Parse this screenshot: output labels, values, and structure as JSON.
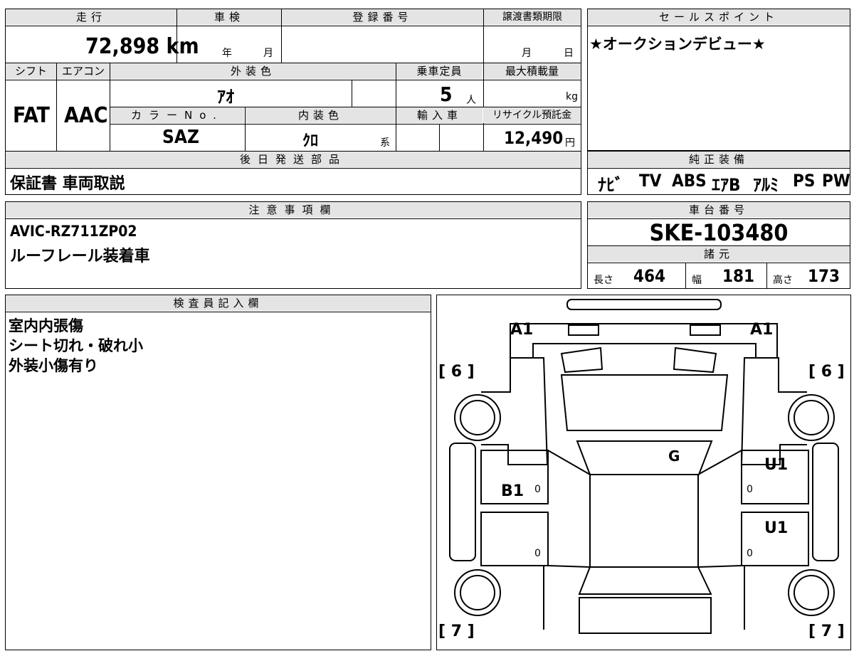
{
  "top_grid": {
    "mileage_header": "走行",
    "shaken_header": "車検",
    "registration_header": "登録番号",
    "transfer_deadline_header": "譲渡書類期限",
    "mileage_value": "72,898 km",
    "shaken_year_unit": "年",
    "shaken_month_unit": "月",
    "deadline_month_unit": "月",
    "deadline_day_unit": "日",
    "shift_header": "シフト",
    "ac_header": "エアコン",
    "exterior_color_header": "外装色",
    "capacity_header": "乗車定員",
    "max_load_header": "最大積載量",
    "shift_value": "FAT",
    "ac_value": "AAC",
    "exterior_color_value": "ｱｵ",
    "capacity_value": "5",
    "capacity_unit": "人",
    "max_load_unit": "kg",
    "color_no_header": "カラーNo.",
    "interior_color_header": "内装色",
    "import_header": "輸入車",
    "recycle_header": "リサイクル預託金",
    "color_no_value": "SAZ",
    "interior_color_value": "ｸﾛ",
    "interior_color_suffix": "系",
    "recycle_value": "12,490",
    "recycle_unit": "円",
    "later_parts_header": "後日発送部品",
    "later_parts_value": "保証書 車両取説"
  },
  "sales_point": {
    "header": "セールスポイント",
    "text": "★オークションデビュー★"
  },
  "genuine_equipment": {
    "header": "純正装備",
    "items": [
      "ﾅﾋﾞ",
      "TV",
      "ABS",
      "ｴｱB",
      "ｱﾙﾐ",
      "PS",
      "PW"
    ]
  },
  "notes": {
    "header": "注意事項欄",
    "lines": [
      "AVIC-RZ711ZP02",
      "ルーフレール装着車"
    ]
  },
  "chassis": {
    "header": "車台番号",
    "value": "SKE-103480"
  },
  "specs": {
    "header": "諸元",
    "length_label": "長さ",
    "length_value": "464",
    "width_label": "幅",
    "width_value": "181",
    "height_label": "高さ",
    "height_value": "173"
  },
  "inspector": {
    "header": "検査員記入欄",
    "lines": [
      "室内内張傷",
      "シート切れ・破れ小",
      "外装小傷有り"
    ]
  },
  "diagram": {
    "labels": {
      "front_left": "A1",
      "front_right": "A1",
      "front_left_tire": "[ 6 ]",
      "front_right_tire": "[ 6 ]",
      "rear_left_tire": "[ 7 ]",
      "rear_right_tire": "[ 7 ]",
      "roof": "G",
      "left_front_door": "B1",
      "right_front_door": "U1",
      "right_rear_door": "U1",
      "zero_1": "0",
      "zero_2": "0",
      "zero_3": "0",
      "zero_4": "0"
    }
  }
}
